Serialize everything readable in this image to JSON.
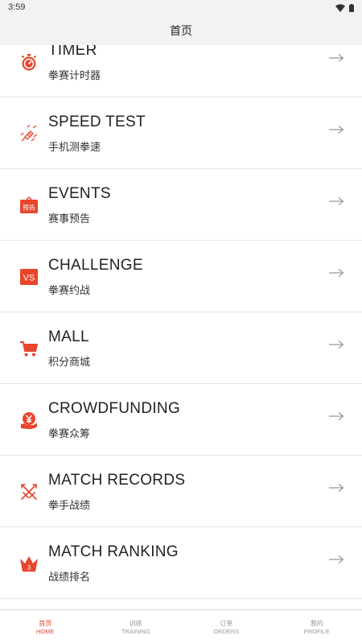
{
  "status_bar": {
    "time": "3:59",
    "wifi_icon": "wifi-icon",
    "battery_icon": "battery-icon"
  },
  "header": {
    "title": "首页"
  },
  "accent_color": "#e8452c",
  "menu": [
    {
      "title": "TIMER",
      "subtitle": "拳赛计时器",
      "icon": "stopwatch-icon"
    },
    {
      "title": "SPEED TEST",
      "subtitle": "手机测拳速",
      "icon": "speed-fist-icon"
    },
    {
      "title": "EVENTS",
      "subtitle": "赛事预告",
      "icon": "events-preview-icon",
      "icon_text": "预告"
    },
    {
      "title": "CHALLENGE",
      "subtitle": "拳赛约战",
      "icon": "vs-icon",
      "icon_text": "VS"
    },
    {
      "title": "MALL",
      "subtitle": "积分商城",
      "icon": "cart-icon"
    },
    {
      "title": "CROWDFUNDING",
      "subtitle": "拳赛众筹",
      "icon": "yuan-hand-icon"
    },
    {
      "title": "MATCH RECORDS",
      "subtitle": "拳手战绩",
      "icon": "crossed-swords-icon"
    },
    {
      "title": "MATCH RANKING",
      "subtitle": "战绩排名",
      "icon": "crown-icon",
      "icon_text": "3"
    }
  ],
  "tabbar": {
    "active": "home",
    "tabs": [
      {
        "cn": "首页",
        "en": "HOME"
      },
      {
        "cn": "训练",
        "en": "TRAINING"
      },
      {
        "cn": "订单",
        "en": "ORDERS"
      },
      {
        "cn": "我的",
        "en": "PROFILE"
      }
    ]
  }
}
